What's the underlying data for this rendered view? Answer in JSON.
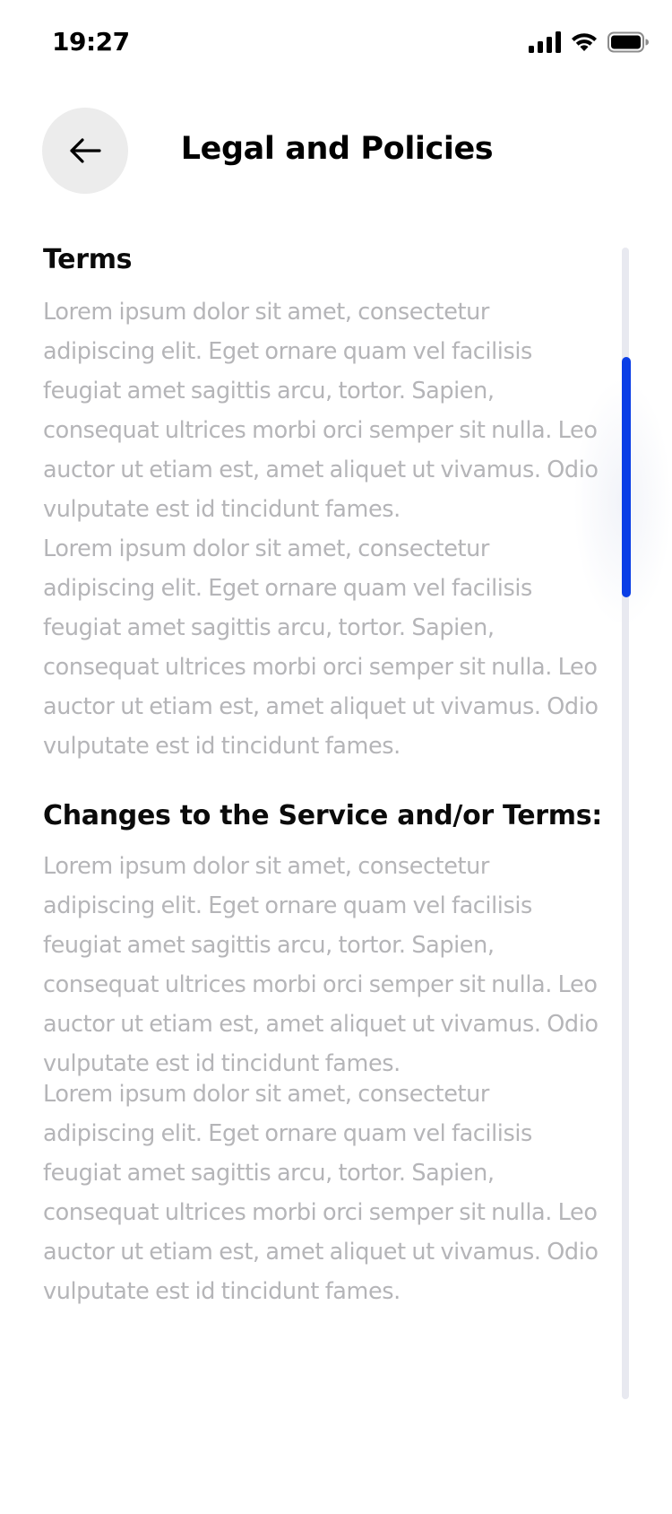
{
  "status_bar": {
    "time": "19:27",
    "icons": [
      "cellular-signal-icon",
      "wifi-icon",
      "battery-icon"
    ]
  },
  "header": {
    "back_icon": "arrow-left-icon",
    "title": "Legal and Policies"
  },
  "sections": {
    "terms": {
      "heading": "Terms",
      "paragraphs": [
        "Lorem ipsum dolor sit amet, consectetur adipiscing elit. Eget ornare quam vel facilisis feugiat amet sagittis arcu, tortor. Sapien, consequat ultrices morbi orci semper sit nulla. Leo auctor ut etiam est, amet aliquet ut vivamus. Odio vulputate est id tincidunt fames.",
        "Lorem ipsum dolor sit amet, consectetur adipiscing elit. Eget ornare quam vel facilisis feugiat amet sagittis arcu, tortor. Sapien, consequat ultrices morbi orci semper sit nulla. Leo auctor ut etiam est, amet aliquet ut vivamus. Odio vulputate est id tincidunt fames."
      ]
    },
    "changes": {
      "heading": "Changes to the Service and/or Terms:",
      "paragraphs": [
        "Lorem ipsum dolor sit amet, consectetur adipiscing elit. Eget ornare quam vel facilisis feugiat amet sagittis arcu, tortor. Sapien, consequat ultrices morbi orci semper sit nulla. Leo auctor ut etiam est, amet aliquet ut vivamus. Odio vulputate est id tincidunt fames.",
        "Lorem ipsum dolor sit amet, consectetur adipiscing elit. Eget ornare quam vel facilisis feugiat amet sagittis arcu, tortor. Sapien, consequat ultrices morbi orci semper sit nulla. Leo auctor ut etiam est, amet aliquet ut vivamus. Odio vulputate est id tincidunt fames."
      ]
    }
  },
  "colors": {
    "accent": "#0a3ee6",
    "body_text": "#b5b5b8",
    "heading_text": "#0b0b0b",
    "back_button_bg": "#ececec",
    "scroll_track": "#e8e9f0"
  },
  "scroll": {
    "position_fraction": 0.1
  }
}
